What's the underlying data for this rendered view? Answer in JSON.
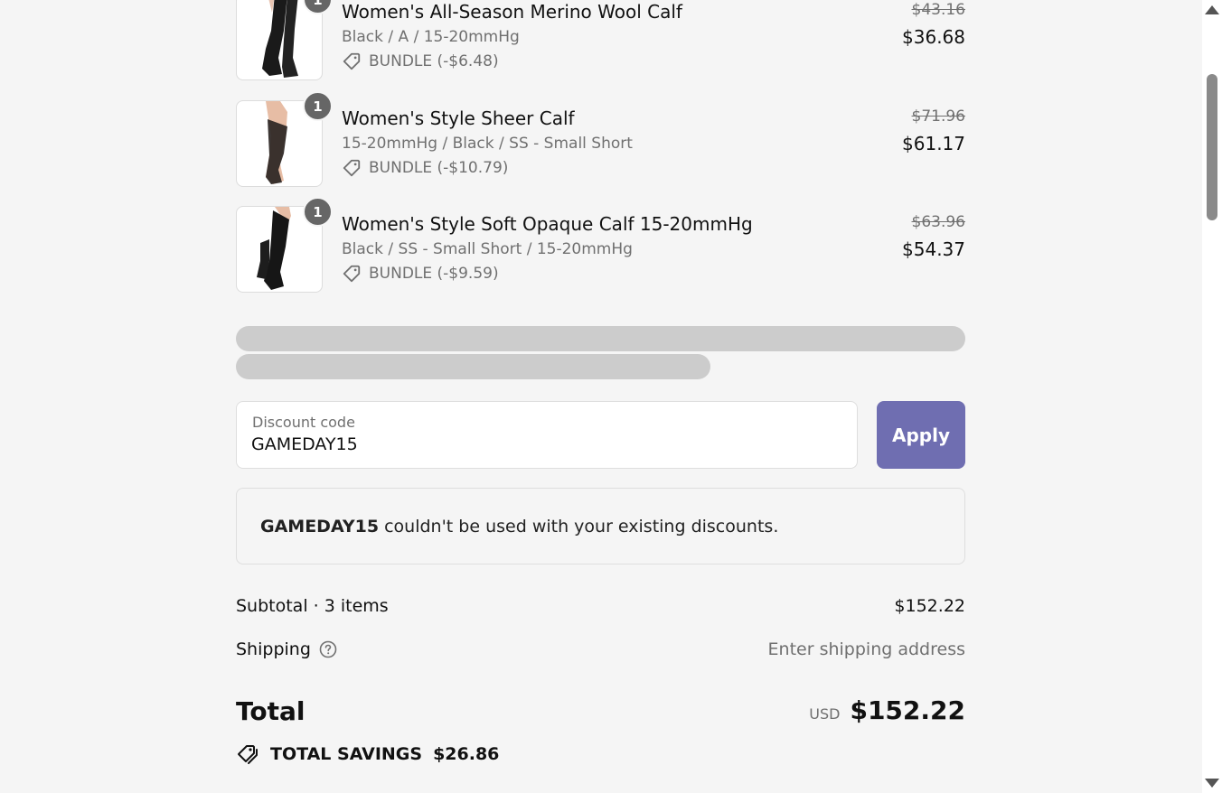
{
  "products": [
    {
      "name": "Women's All-Season Merino Wool Calf",
      "variant": "Black / A / 15-20mmHg",
      "bundle": "BUNDLE (-$6.48)",
      "original_price": "$43.16",
      "price": "$36.68",
      "quantity": "1"
    },
    {
      "name": "Women's Style Sheer Calf",
      "variant": "15-20mmHg / Black / SS - Small Short",
      "bundle": "BUNDLE (-$10.79)",
      "original_price": "$71.96",
      "price": "$61.17",
      "quantity": "1"
    },
    {
      "name": "Women's Style Soft Opaque Calf 15-20mmHg",
      "variant": "Black / SS - Small Short / 15-20mmHg",
      "bundle": "BUNDLE (-$9.59)",
      "original_price": "$63.96",
      "price": "$54.37",
      "quantity": "1"
    }
  ],
  "discount": {
    "label": "Discount code",
    "value": "GAMEDAY15",
    "apply_label": "Apply",
    "error_code": "GAMEDAY15",
    "error_message": " couldn't be used with your existing discounts."
  },
  "summary": {
    "subtotal_label": "Subtotal · 3 items",
    "subtotal_value": "$152.22",
    "shipping_label": "Shipping",
    "shipping_value": "Enter shipping address",
    "total_label": "Total",
    "total_currency": "USD",
    "total_value": "$152.22",
    "savings_label": "TOTAL SAVINGS",
    "savings_value": "$26.86"
  },
  "colors": {
    "apply_button": "#6f6eb1",
    "badge": "#666666",
    "muted_text": "#707070",
    "skeleton": "#cccccc"
  },
  "icons": {
    "bundle": "tag-icon",
    "shipping_help": "question-circle-icon",
    "savings": "tags-icon"
  }
}
